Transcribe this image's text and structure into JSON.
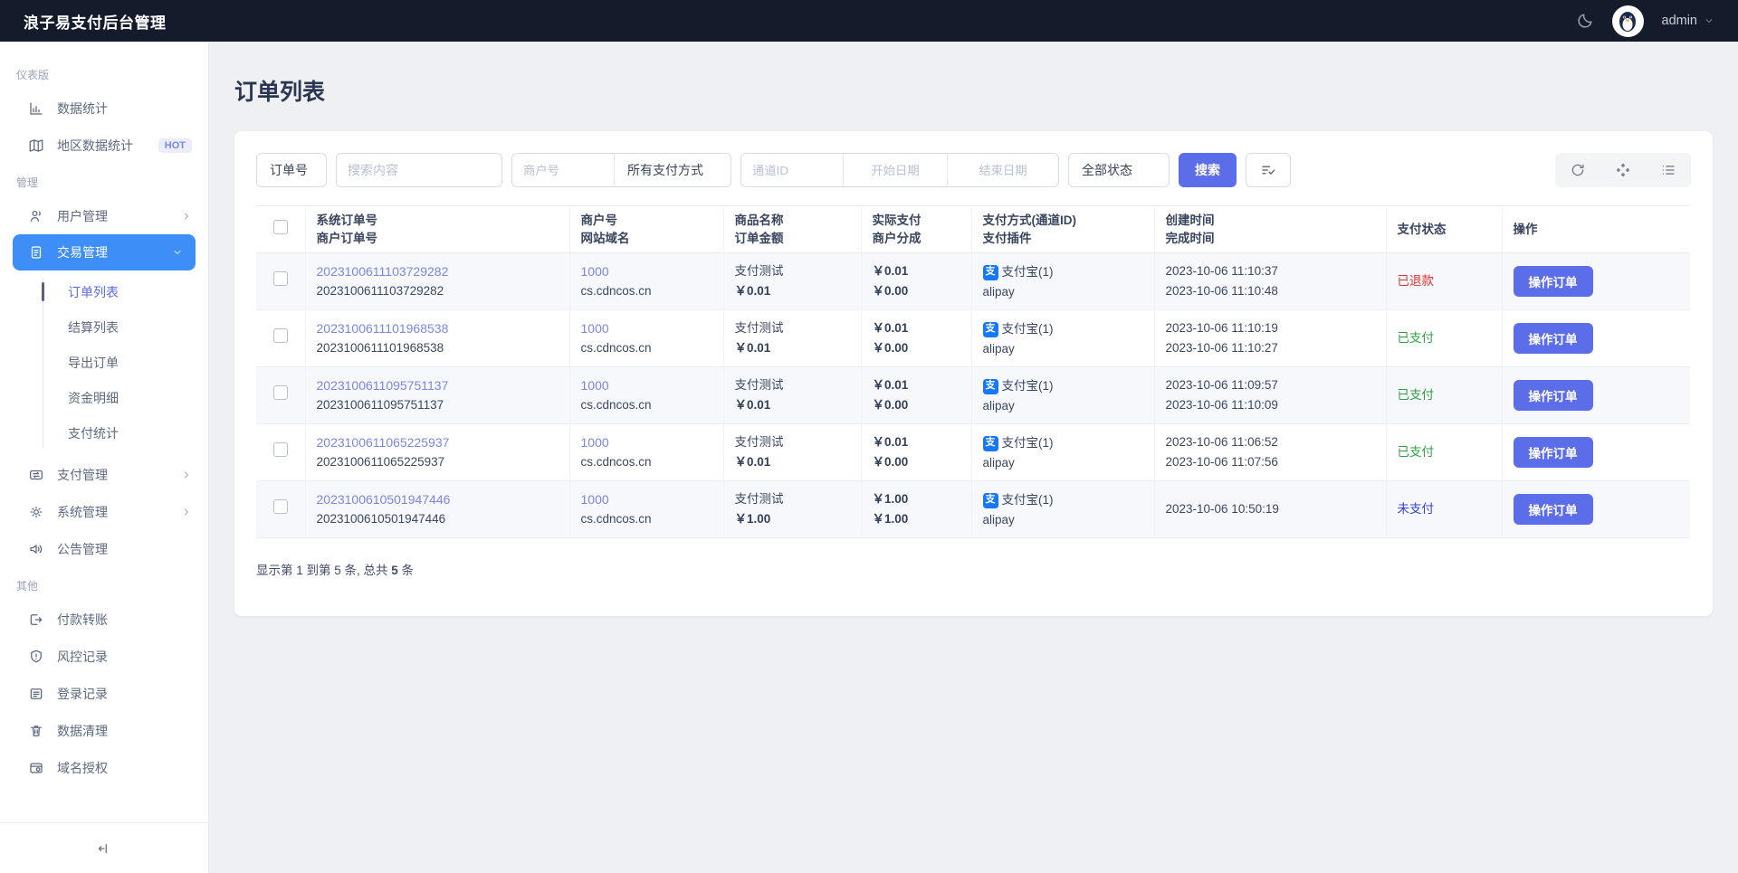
{
  "theme": {
    "topbar_bg": "#141c2b",
    "sidebar_active_bg": "#3e8ef7",
    "accent_indigo": "#5c6de9",
    "link_color": "#7b86e2",
    "status_refunded_color": "#e03131",
    "status_paid_color": "#2f9e44",
    "status_unpaid_color": "#3346d3",
    "alipay_blue": "#1677ff"
  },
  "topbar": {
    "title": "浪子易支付后台管理",
    "username": "admin"
  },
  "sidebar": {
    "sections": [
      {
        "label": "仪表版",
        "items": [
          {
            "label": "数据统计"
          },
          {
            "label": "地区数据统计",
            "badge": "HOT"
          }
        ]
      },
      {
        "label": "管理",
        "items": [
          {
            "label": "用户管理"
          },
          {
            "label": "交易管理",
            "children": [
              {
                "label": "订单列表"
              },
              {
                "label": "结算列表"
              },
              {
                "label": "导出订单"
              },
              {
                "label": "资金明细"
              },
              {
                "label": "支付统计"
              }
            ]
          },
          {
            "label": "支付管理"
          },
          {
            "label": "系统管理"
          },
          {
            "label": "公告管理"
          }
        ]
      },
      {
        "label": "其他",
        "items": [
          {
            "label": "付款转账"
          },
          {
            "label": "风控记录"
          },
          {
            "label": "登录记录"
          },
          {
            "label": "数据清理"
          },
          {
            "label": "域名授权"
          }
        ]
      }
    ]
  },
  "page": {
    "title": "订单列表"
  },
  "filters": {
    "order_field_select": "订单号",
    "search_placeholder": "搜索内容",
    "merchant_placeholder": "商户号",
    "pay_method_select": "所有支付方式",
    "channel_placeholder": "通道ID",
    "start_date_placeholder": "开始日期",
    "end_date_placeholder": "结束日期",
    "status_select": "全部状态",
    "search_button": "搜索"
  },
  "table": {
    "headers": [
      {
        "line1": "系统订单号",
        "line2": "商户订单号"
      },
      {
        "line1": "商户号",
        "line2": "网站域名"
      },
      {
        "line1": "商品名称",
        "line2": "订单金额"
      },
      {
        "line1": "实际支付",
        "line2": "商户分成"
      },
      {
        "line1": "支付方式(通道ID)",
        "line2": "支付插件"
      },
      {
        "line1": "创建时间",
        "line2": "完成时间"
      },
      {
        "line1": "支付状态"
      },
      {
        "line1": "操作"
      }
    ],
    "alipay_glyph": "支",
    "action_label": "操作订单",
    "rows": [
      {
        "sys_order": "2023100611103729282",
        "mch_order": "2023100611103729282",
        "merchant_id": "1000",
        "domain": "cs.cdncos.cn",
        "product": "支付测试",
        "amount": "￥0.01",
        "paid": "￥0.01",
        "share": "￥0.00",
        "method": "支付宝(1)",
        "plugin": "alipay",
        "created": "2023-10-06 11:10:37",
        "completed": "2023-10-06 11:10:48",
        "status": "已退款",
        "status_type": "refunded"
      },
      {
        "sys_order": "2023100611101968538",
        "mch_order": "2023100611101968538",
        "merchant_id": "1000",
        "domain": "cs.cdncos.cn",
        "product": "支付测试",
        "amount": "￥0.01",
        "paid": "￥0.01",
        "share": "￥0.00",
        "method": "支付宝(1)",
        "plugin": "alipay",
        "created": "2023-10-06 11:10:19",
        "completed": "2023-10-06 11:10:27",
        "status": "已支付",
        "status_type": "paid"
      },
      {
        "sys_order": "2023100611095751137",
        "mch_order": "2023100611095751137",
        "merchant_id": "1000",
        "domain": "cs.cdncos.cn",
        "product": "支付测试",
        "amount": "￥0.01",
        "paid": "￥0.01",
        "share": "￥0.00",
        "method": "支付宝(1)",
        "plugin": "alipay",
        "created": "2023-10-06 11:09:57",
        "completed": "2023-10-06 11:10:09",
        "status": "已支付",
        "status_type": "paid"
      },
      {
        "sys_order": "2023100611065225937",
        "mch_order": "2023100611065225937",
        "merchant_id": "1000",
        "domain": "cs.cdncos.cn",
        "product": "支付测试",
        "amount": "￥0.01",
        "paid": "￥0.01",
        "share": "￥0.00",
        "method": "支付宝(1)",
        "plugin": "alipay",
        "created": "2023-10-06 11:06:52",
        "completed": "2023-10-06 11:07:56",
        "status": "已支付",
        "status_type": "paid"
      },
      {
        "sys_order": "2023100610501947446",
        "mch_order": "2023100610501947446",
        "merchant_id": "1000",
        "domain": "cs.cdncos.cn",
        "product": "支付测试",
        "amount": "￥1.00",
        "paid": "￥1.00",
        "share": "￥1.00",
        "method": "支付宝(1)",
        "plugin": "alipay",
        "created": "2023-10-06 10:50:19",
        "completed": "",
        "status": "未支付",
        "status_type": "unpaid"
      }
    ]
  },
  "footer": {
    "prefix": "显示第 1 到第 5 条, 总共 ",
    "total": "5",
    "suffix": " 条"
  }
}
